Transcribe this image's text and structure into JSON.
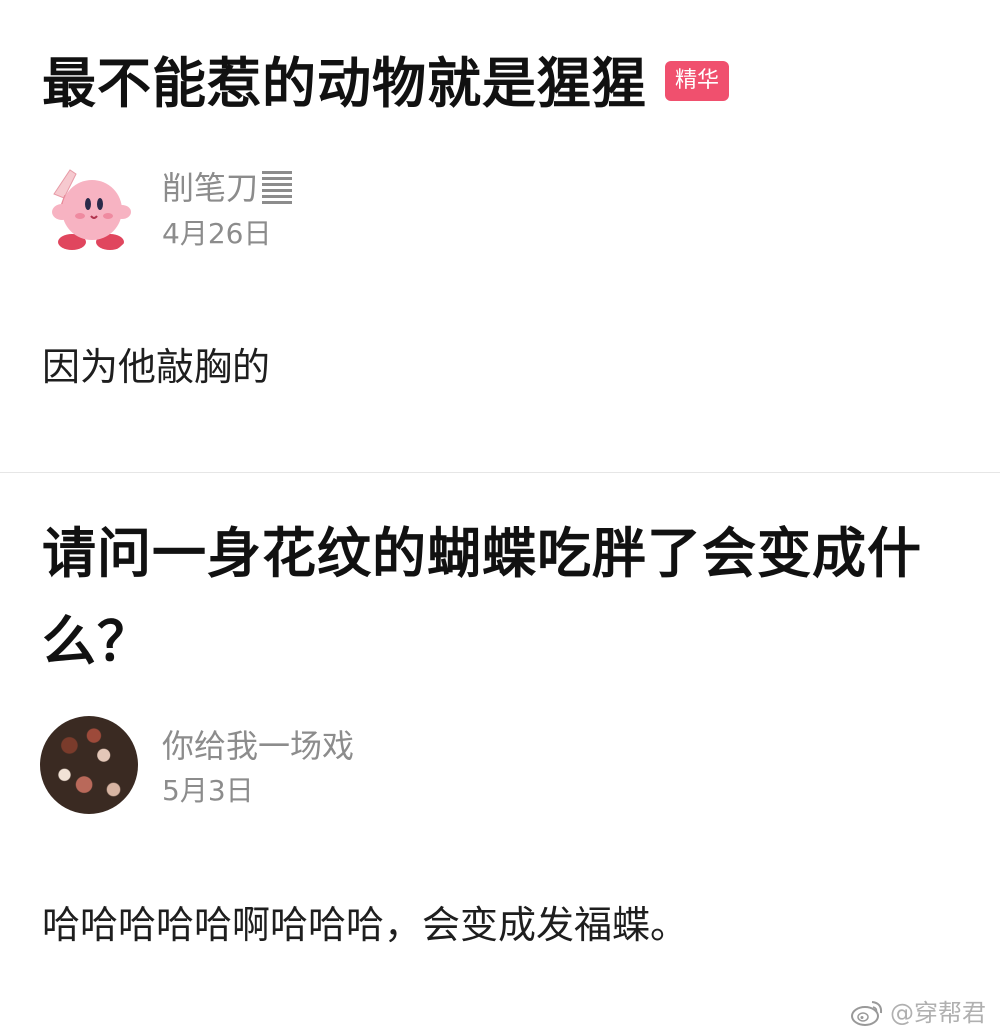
{
  "posts": [
    {
      "title": "最不能惹的动物就是猩猩",
      "badge": "精华",
      "author": "削笔刀",
      "date": "4月26日",
      "body": "因为他敲胸的",
      "avatar_icon": "kirby-avatar-icon"
    },
    {
      "title": "请问一身花纹的蝴蝶吃胖了会变成什么？",
      "author": "你给我一场戏",
      "date": "5月3日",
      "body": "哈哈哈哈哈啊哈哈哈，会变成发福蝶。",
      "avatar_icon": "floral-avatar-icon"
    }
  ],
  "watermark": {
    "text": "@穿帮君",
    "icon": "weibo-icon"
  },
  "colors": {
    "badge": "#f0506e",
    "meta_text": "#8c8c8c",
    "divider": "#e6e6e6"
  }
}
